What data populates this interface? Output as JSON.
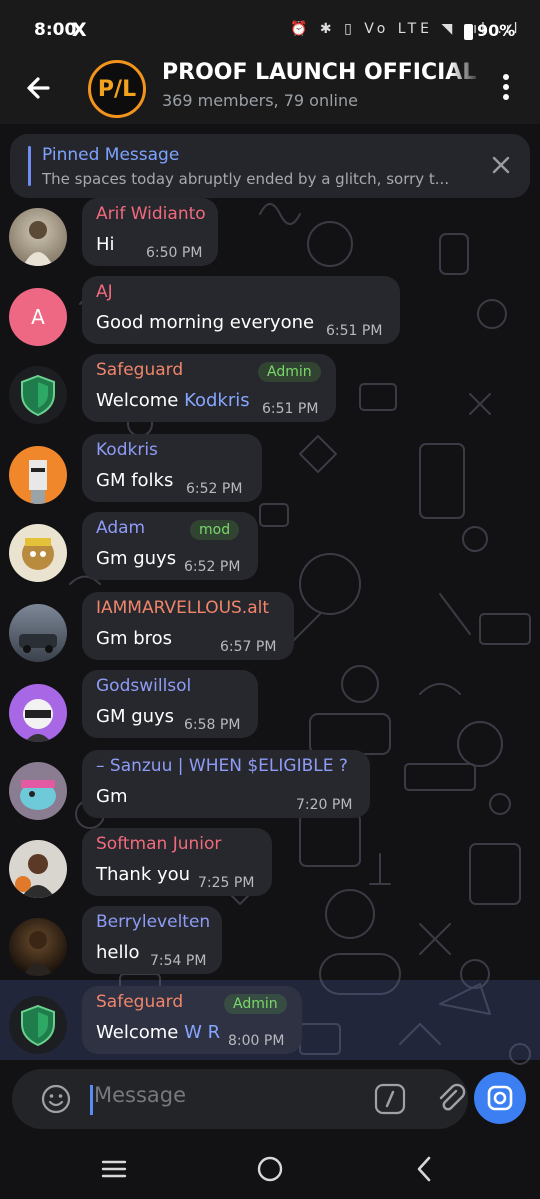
{
  "status_bar": {
    "time": "8:00",
    "x_icon": "X",
    "icons": "⏰ ✱ ▯ Vo LTE ◥ .ıl .ıl",
    "battery": "90%"
  },
  "header": {
    "avatar_text": "P/L",
    "title": "PROOF LAUNCH OFFICIAL C",
    "subtitle": "369 members, 79 online"
  },
  "pinned": {
    "title": "Pinned Message",
    "text": "The spaces today abruptly ended by  a glitch, sorry t..."
  },
  "messages": [
    {
      "sender": "Arif Widianto",
      "text": "Hi",
      "time": "6:50 PM"
    },
    {
      "sender": "AJ",
      "avatar_letter": "A",
      "text": "Good morning everyone",
      "time": "6:51 PM"
    },
    {
      "sender": "Safeguard",
      "badge": "Admin",
      "text": "Welcome ",
      "mention": "Kodkris",
      "time": "6:51 PM"
    },
    {
      "sender": "Kodkris",
      "text": "GM folks",
      "time": "6:52 PM"
    },
    {
      "sender": "Adam",
      "badge": "mod",
      "text": "Gm guys",
      "time": "6:52 PM"
    },
    {
      "sender": "IAMMARVELLOUS.alt",
      "text": "Gm bros",
      "time": "6:57 PM"
    },
    {
      "sender": "Godswillsol",
      "text": "GM guys",
      "time": "6:58 PM"
    },
    {
      "sender": "– Sanzuu | WHEN $ELIGIBLE ?",
      "text": "Gm",
      "time": "7:20 PM"
    },
    {
      "sender": "Softman Junior",
      "text": "Thank you",
      "time": "7:25 PM"
    },
    {
      "sender": "Berrylevelten",
      "text": "hello",
      "time": "7:54 PM"
    },
    {
      "sender": "Safeguard",
      "badge": "Admin",
      "text": "Welcome ",
      "mention": "W R",
      "time": "8:00 PM"
    }
  ],
  "composer": {
    "placeholder": "Message"
  },
  "colors": {
    "accent": "#3b7ff2",
    "name_red": "#f06a7c",
    "name_blue": "#8e9cf7",
    "name_orange": "#f0856b",
    "admin_green": "#7bd86a",
    "bubble": "#27282d"
  }
}
